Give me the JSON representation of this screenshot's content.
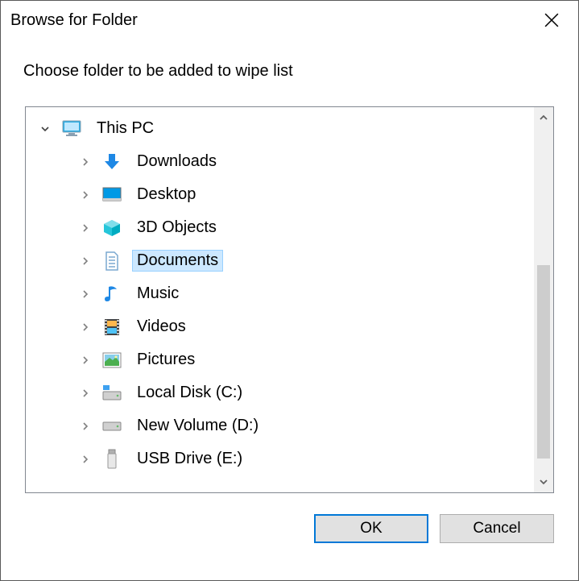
{
  "dialog": {
    "title": "Browse for Folder",
    "instruction": "Choose folder to be added to wipe list"
  },
  "tree": {
    "root": {
      "label": "This PC",
      "icon": "pc-monitor",
      "expanded": true
    },
    "children": [
      {
        "label": "Downloads",
        "icon": "download-arrow",
        "selected": false
      },
      {
        "label": "Desktop",
        "icon": "desktop-screen",
        "selected": false
      },
      {
        "label": "3D Objects",
        "icon": "cube-3d",
        "selected": false
      },
      {
        "label": "Documents",
        "icon": "document-page",
        "selected": true
      },
      {
        "label": "Music",
        "icon": "music-note",
        "selected": false
      },
      {
        "label": "Videos",
        "icon": "film-strip",
        "selected": false
      },
      {
        "label": "Pictures",
        "icon": "landscape-photo",
        "selected": false
      },
      {
        "label": "Local Disk (C:)",
        "icon": "hard-drive",
        "selected": false
      },
      {
        "label": "New Volume (D:)",
        "icon": "hard-drive",
        "selected": false
      },
      {
        "label": "USB Drive (E:)",
        "icon": "usb-drive",
        "selected": false
      }
    ]
  },
  "buttons": {
    "ok": "OK",
    "cancel": "Cancel"
  }
}
